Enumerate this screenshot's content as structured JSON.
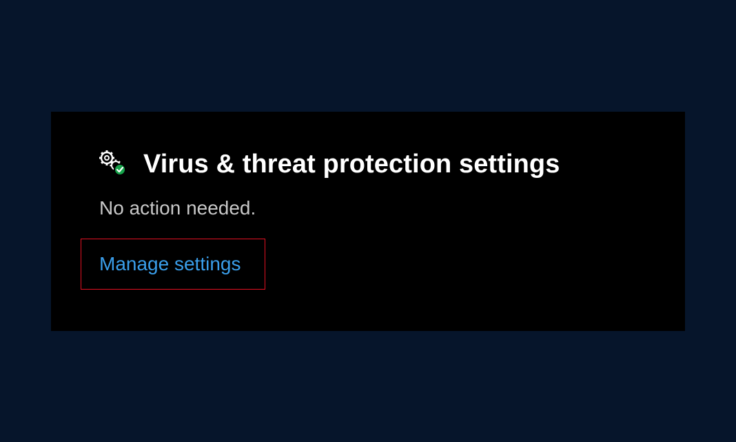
{
  "card": {
    "icon": "gear-shield-check-icon",
    "title": "Virus & threat protection settings",
    "status": "No action needed.",
    "link_label": "Manage settings"
  },
  "colors": {
    "page_background": "#06152b",
    "panel_background": "#000000",
    "title": "#ffffff",
    "status": "#c8c8c8",
    "link": "#3a9eea",
    "focus_outline": "#e81123",
    "check_badge": "#16a34a"
  }
}
